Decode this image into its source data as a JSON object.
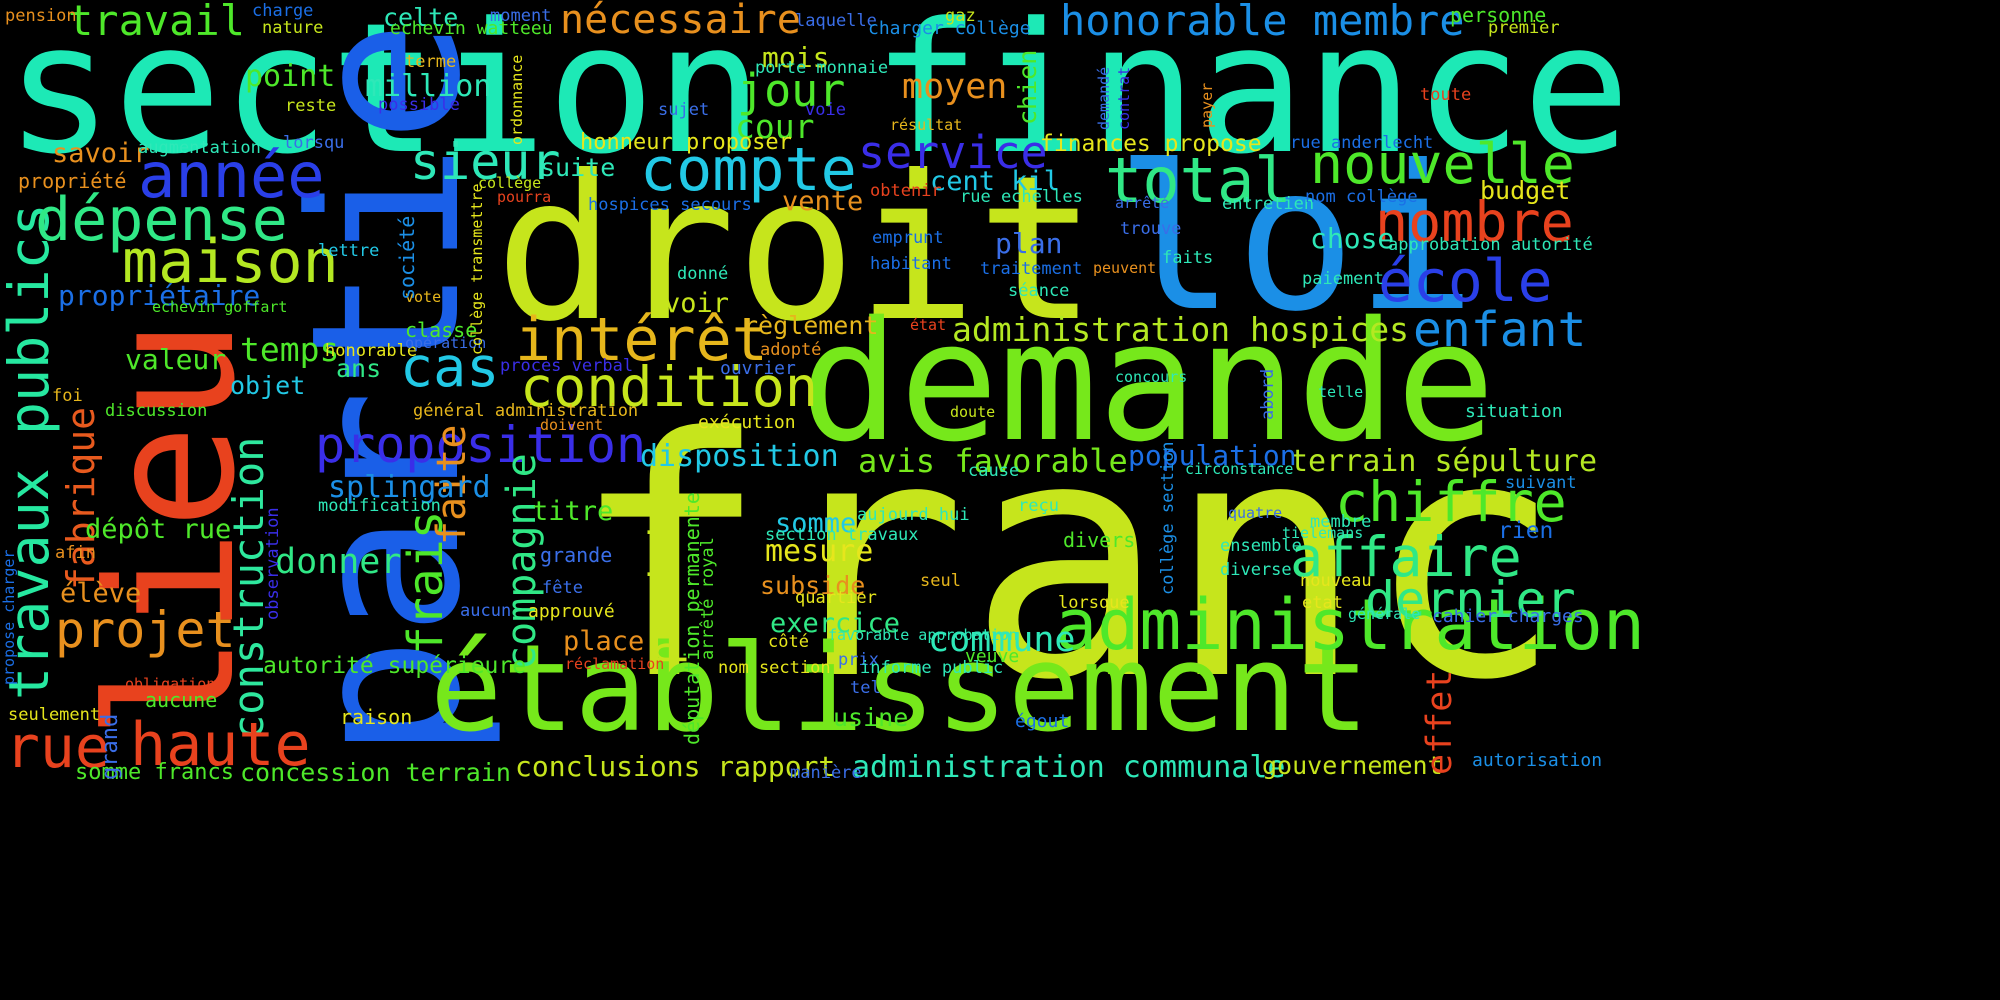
{
  "words": [
    {
      "text": "section finance",
      "color": "#1de9b6",
      "vertical": false
    },
    {
      "text": "franc",
      "color": "#c6e51c",
      "vertical": false
    },
    {
      "text": "partie",
      "color": "#1a5fe8",
      "vertical": true
    },
    {
      "text": "lieu",
      "color": "#e8421e",
      "vertical": true
    },
    {
      "text": "droit",
      "color": "#c6e51c",
      "vertical": false
    },
    {
      "text": "loi",
      "color": "#1b8fe6",
      "vertical": false
    },
    {
      "text": "demande",
      "color": "#76e81b",
      "vertical": false
    },
    {
      "text": "établissement",
      "color": "#76e81b",
      "vertical": false
    },
    {
      "text": "administration",
      "color": "#4ee82a",
      "vertical": false
    },
    {
      "text": "travaux publics",
      "color": "#26e8a0",
      "vertical": true
    },
    {
      "text": "construction",
      "color": "#2ee89e",
      "vertical": true
    },
    {
      "text": "compte",
      "color": "#22c9e6",
      "vertical": false
    },
    {
      "text": "année",
      "color": "#2a3fe8",
      "vertical": false
    },
    {
      "text": "dépense",
      "color": "#30e886",
      "vertical": false
    },
    {
      "text": "maison",
      "color": "#b4e822",
      "vertical": false
    },
    {
      "text": "condition",
      "color": "#c6e51c",
      "vertical": false
    },
    {
      "text": "intérêt",
      "color": "#e6b61c",
      "vertical": false
    },
    {
      "text": "proposition",
      "color": "#3a2ee8",
      "vertical": false
    },
    {
      "text": "cas",
      "color": "#22c9e6",
      "vertical": false
    },
    {
      "text": "sieur",
      "color": "#2ee8b8",
      "vertical": false
    },
    {
      "text": "total",
      "color": "#30e886",
      "vertical": false
    },
    {
      "text": "nouvelle",
      "color": "#4ee82a",
      "vertical": false
    },
    {
      "text": "nombre",
      "color": "#e8421e",
      "vertical": false
    },
    {
      "text": "école",
      "color": "#2a3fe8",
      "vertical": false
    },
    {
      "text": "enfant",
      "color": "#1b8fe6",
      "vertical": false
    },
    {
      "text": "chiffre",
      "color": "#4ee82a",
      "vertical": false
    },
    {
      "text": "affaire",
      "color": "#30e886",
      "vertical": false
    },
    {
      "text": "dernier",
      "color": "#30e886",
      "vertical": false
    },
    {
      "text": "haute",
      "color": "#e8421e",
      "vertical": false
    },
    {
      "text": "rue",
      "color": "#e8421e",
      "vertical": false
    },
    {
      "text": "projet",
      "color": "#e8901e",
      "vertical": false
    },
    {
      "text": "fabrique",
      "color": "#e85a1e",
      "vertical": true
    },
    {
      "text": "frais",
      "color": "#4ee82a",
      "vertical": true
    },
    {
      "text": "faite",
      "color": "#e8901e",
      "vertical": true
    },
    {
      "text": "compagnie",
      "color": "#30e886",
      "vertical": true
    },
    {
      "text": "produit",
      "color": "#c6e51c",
      "vertical": true
    },
    {
      "text": "jour",
      "color": "#4ee82a",
      "vertical": false
    },
    {
      "text": "service",
      "color": "#3a2ee8",
      "vertical": false
    },
    {
      "text": "travail",
      "color": "#4ee82a",
      "vertical": false
    },
    {
      "text": "nécessaire",
      "color": "#e8901e",
      "vertical": false
    },
    {
      "text": "honorable membre",
      "color": "#1b8fe6",
      "vertical": false
    },
    {
      "text": "administration hospices",
      "color": "#b4e822",
      "vertical": false
    },
    {
      "text": "avis favorable",
      "color": "#76e81b",
      "vertical": false
    },
    {
      "text": "terrain sépulture",
      "color": "#b4e822",
      "vertical": false
    },
    {
      "text": "administration communale",
      "color": "#2ee8b8",
      "vertical": false
    },
    {
      "text": "conclusions rapport",
      "color": "#c6e51c",
      "vertical": false
    },
    {
      "text": "gouvernement",
      "color": "#c6e51c",
      "vertical": false
    },
    {
      "text": "concession terrain",
      "color": "#4ee82a",
      "vertical": false
    },
    {
      "text": "somme francs",
      "color": "#4ee82a",
      "vertical": false
    },
    {
      "text": "commune",
      "color": "#2ee8b8",
      "vertical": false
    },
    {
      "text": "exercice",
      "color": "#30e886",
      "vertical": false
    },
    {
      "text": "disposition",
      "color": "#22c9e6",
      "vertical": false
    },
    {
      "text": "splingard",
      "color": "#1b8fe6",
      "vertical": false
    },
    {
      "text": "mesure",
      "color": "#e6e61c",
      "vertical": false
    },
    {
      "text": "subside",
      "color": "#e8901e",
      "vertical": false
    },
    {
      "text": "somme",
      "color": "#22c9e6",
      "vertical": false
    },
    {
      "text": "donner",
      "color": "#30e886",
      "vertical": false
    },
    {
      "text": "temps",
      "color": "#4ee82a",
      "vertical": false
    },
    {
      "text": "propriétaire",
      "color": "#1b6fe6",
      "vertical": false
    },
    {
      "text": "valeur",
      "color": "#4ee82a",
      "vertical": false
    },
    {
      "text": "objet",
      "color": "#22c9e6",
      "vertical": false
    },
    {
      "text": "ans",
      "color": "#30e886",
      "vertical": false
    },
    {
      "text": "usine",
      "color": "#4ee82a",
      "vertical": false
    },
    {
      "text": "place",
      "color": "#e8901e",
      "vertical": false
    },
    {
      "text": "titre",
      "color": "#4ee82a",
      "vertical": false
    },
    {
      "text": "voir",
      "color": "#c6e51c",
      "vertical": false
    },
    {
      "text": "règlement",
      "color": "#e6b61c",
      "vertical": false
    },
    {
      "text": "plan",
      "color": "#3a6ee8",
      "vertical": false
    },
    {
      "text": "chose",
      "color": "#2ee8b8",
      "vertical": false
    },
    {
      "text": "population",
      "color": "#1b6fe6",
      "vertical": false
    },
    {
      "text": "budget",
      "color": "#e6e61c",
      "vertical": false
    },
    {
      "text": "cour",
      "color": "#4ee82a",
      "vertical": false
    },
    {
      "text": "mois",
      "color": "#c6e51c",
      "vertical": false
    },
    {
      "text": "moyen",
      "color": "#e8901e",
      "vertical": false
    },
    {
      "text": "point",
      "color": "#4ee82a",
      "vertical": false
    },
    {
      "text": "million",
      "color": "#2ee8b8",
      "vertical": false
    },
    {
      "text": "celte",
      "color": "#2ee8b8",
      "vertical": false
    },
    {
      "text": "savoir",
      "color": "#e8901e",
      "vertical": false
    },
    {
      "text": "dépôt rue",
      "color": "#4ee82a",
      "vertical": false
    },
    {
      "text": "élève",
      "color": "#e8901e",
      "vertical": false
    },
    {
      "text": "autorité supérieure",
      "color": "#4ee82a",
      "vertical": false
    },
    {
      "text": "suite",
      "color": "#2ee8b8",
      "vertical": false
    },
    {
      "text": "vente",
      "color": "#e8901e",
      "vertical": false
    },
    {
      "text": "cent kil",
      "color": "#22c9e6",
      "vertical": false
    },
    {
      "text": "finances propose",
      "color": "#e6e61c",
      "vertical": false
    },
    {
      "text": "honneur proposer",
      "color": "#e6e61c",
      "vertical": false
    },
    {
      "text": "pension",
      "color": "#e8901e",
      "vertical": false
    },
    {
      "text": "charge",
      "color": "#1b6fe6",
      "vertical": false
    },
    {
      "text": "nature",
      "color": "#c6e51c",
      "vertical": false
    },
    {
      "text": "echevin watteeu",
      "color": "#4ee82a",
      "vertical": false
    },
    {
      "text": "moment",
      "color": "#3a6ee8",
      "vertical": false
    },
    {
      "text": "laquelle",
      "color": "#3a6ee8",
      "vertical": false
    },
    {
      "text": "charger collège",
      "color": "#1b8fe6",
      "vertical": false
    },
    {
      "text": "gaz",
      "color": "#c6e51c",
      "vertical": false
    },
    {
      "text": "personne",
      "color": "#4ee82a",
      "vertical": false
    },
    {
      "text": "premier",
      "color": "#c6e51c",
      "vertical": false
    },
    {
      "text": "terme",
      "color": "#e6b61c",
      "vertical": false
    },
    {
      "text": "porte monnaie",
      "color": "#2ee8b8",
      "vertical": false
    },
    {
      "text": "reste",
      "color": "#c6e51c",
      "vertical": false
    },
    {
      "text": "possible",
      "color": "#3a2ee8",
      "vertical": false
    },
    {
      "text": "sujet",
      "color": "#3a6ee8",
      "vertical": false
    },
    {
      "text": "voie",
      "color": "#3a2ee8",
      "vertical": false
    },
    {
      "text": "résultat",
      "color": "#e6b61c",
      "vertical": false
    },
    {
      "text": "toute",
      "color": "#e8421e",
      "vertical": false
    },
    {
      "text": "rue anderlecht",
      "color": "#1b6fe6",
      "vertical": false
    },
    {
      "text": "augmentation",
      "color": "#2ee8b8",
      "vertical": false
    },
    {
      "text": "lorsqu",
      "color": "#3a6ee8",
      "vertical": false
    },
    {
      "text": "propriété",
      "color": "#e8901e",
      "vertical": false
    },
    {
      "text": "collège",
      "color": "#c6e51c",
      "vertical": false
    },
    {
      "text": "pourra",
      "color": "#e8421e",
      "vertical": false
    },
    {
      "text": "hospices secours",
      "color": "#1b6fe6",
      "vertical": false
    },
    {
      "text": "obtenir",
      "color": "#e8421e",
      "vertical": false
    },
    {
      "text": "rue echelles",
      "color": "#2ee8b8",
      "vertical": false
    },
    {
      "text": "arrêté",
      "color": "#3a6ee8",
      "vertical": false
    },
    {
      "text": "entretien",
      "color": "#2ee8b8",
      "vertical": false
    },
    {
      "text": "nom collège",
      "color": "#1b6fe6",
      "vertical": false
    },
    {
      "text": "trouve",
      "color": "#3a6ee8",
      "vertical": false
    },
    {
      "text": "approbation autorité",
      "color": "#2ee8b8",
      "vertical": false
    },
    {
      "text": "lettre",
      "color": "#22c9e6",
      "vertical": false
    },
    {
      "text": "emprunt",
      "color": "#1b6fe6",
      "vertical": false
    },
    {
      "text": "habitant",
      "color": "#1b6fe6",
      "vertical": false
    },
    {
      "text": "traitement",
      "color": "#1b6fe6",
      "vertical": false
    },
    {
      "text": "faits",
      "color": "#2ee8b8",
      "vertical": false
    },
    {
      "text": "peuvent",
      "color": "#e8901e",
      "vertical": false
    },
    {
      "text": "paiement",
      "color": "#2ee8b8",
      "vertical": false
    },
    {
      "text": "séance",
      "color": "#2ee8b8",
      "vertical": false
    },
    {
      "text": "vote",
      "color": "#e6b61c",
      "vertical": false
    },
    {
      "text": "echevin goffart",
      "color": "#4ee82a",
      "vertical": false
    },
    {
      "text": "classe",
      "color": "#4ee82a",
      "vertical": false
    },
    {
      "text": "honorable",
      "color": "#e6e61c",
      "vertical": false
    },
    {
      "text": "opération",
      "color": "#3a6ee8",
      "vertical": false
    },
    {
      "text": "état",
      "color": "#e8421e",
      "vertical": false
    },
    {
      "text": "adopté",
      "color": "#e8901e",
      "vertical": false
    },
    {
      "text": "donné",
      "color": "#2ee8b8",
      "vertical": false
    },
    {
      "text": "foi",
      "color": "#e6b61c",
      "vertical": false
    },
    {
      "text": "discussion",
      "color": "#4ee82a",
      "vertical": false
    },
    {
      "text": "proces verbal",
      "color": "#3a2ee8",
      "vertical": false
    },
    {
      "text": "ouvrier",
      "color": "#3a6ee8",
      "vertical": false
    },
    {
      "text": "général administration",
      "color": "#e6b61c",
      "vertical": false
    },
    {
      "text": "doivent",
      "color": "#e8901e",
      "vertical": false
    },
    {
      "text": "exécution",
      "color": "#e6e61c",
      "vertical": false
    },
    {
      "text": "doute",
      "color": "#c6e51c",
      "vertical": false
    },
    {
      "text": "concours",
      "color": "#2ee8b8",
      "vertical": false
    },
    {
      "text": "telle",
      "color": "#2ee8b8",
      "vertical": false
    },
    {
      "text": "situation",
      "color": "#2ee8b8",
      "vertical": false
    },
    {
      "text": "cause",
      "color": "#2ee8b8",
      "vertical": false
    },
    {
      "text": "circonstance",
      "color": "#2ee8b8",
      "vertical": false
    },
    {
      "text": "suivant",
      "color": "#1b8fe6",
      "vertical": false
    },
    {
      "text": "reçu",
      "color": "#2ee8b8",
      "vertical": false
    },
    {
      "text": "modification",
      "color": "#2ee8b8",
      "vertical": false
    },
    {
      "text": "aujourd hui",
      "color": "#2ee8b8",
      "vertical": false
    },
    {
      "text": "section travaux",
      "color": "#2ee8b8",
      "vertical": false
    },
    {
      "text": "divers",
      "color": "#4ee82a",
      "vertical": false
    },
    {
      "text": "quatre",
      "color": "#3a6ee8",
      "vertical": false
    },
    {
      "text": "membre",
      "color": "#2ee8b8",
      "vertical": false
    },
    {
      "text": "tielemans",
      "color": "#2ee8b8",
      "vertical": false
    },
    {
      "text": "rien",
      "color": "#1b6fe6",
      "vertical": false
    },
    {
      "text": "ensemble",
      "color": "#2ee8b8",
      "vertical": false
    },
    {
      "text": "diverse",
      "color": "#2ee8b8",
      "vertical": false
    },
    {
      "text": "nouveau",
      "color": "#e6e61c",
      "vertical": false
    },
    {
      "text": "générale",
      "color": "#2ee8b8",
      "vertical": false
    },
    {
      "text": "cahier charges",
      "color": "#3a6ee8",
      "vertical": false
    },
    {
      "text": "etat",
      "color": "#e6e61c",
      "vertical": false
    },
    {
      "text": "lorsque",
      "color": "#e6e61c",
      "vertical": false
    },
    {
      "text": "quartier",
      "color": "#e6e61c",
      "vertical": false
    },
    {
      "text": "seul",
      "color": "#e6b61c",
      "vertical": false
    },
    {
      "text": "fête",
      "color": "#3a6ee8",
      "vertical": false
    },
    {
      "text": "grande",
      "color": "#3a6ee8",
      "vertical": false
    },
    {
      "text": "approuvé",
      "color": "#e6e61c",
      "vertical": false
    },
    {
      "text": "aucun",
      "color": "#3a6ee8",
      "vertical": false
    },
    {
      "text": "côté",
      "color": "#e6e61c",
      "vertical": false
    },
    {
      "text": "favorable approbation",
      "color": "#2ee8b8",
      "vertical": false
    },
    {
      "text": "afin",
      "color": "#e8901e",
      "vertical": false
    },
    {
      "text": "réclamation",
      "color": "#e8421e",
      "vertical": false
    },
    {
      "text": "nom section",
      "color": "#e6e61c",
      "vertical": false
    },
    {
      "text": "prix",
      "color": "#3a6ee8",
      "vertical": false
    },
    {
      "text": "informe public",
      "color": "#2ee8b8",
      "vertical": false
    },
    {
      "text": "veuve",
      "color": "#4ee82a",
      "vertical": false
    },
    {
      "text": "tel",
      "color": "#3a6ee8",
      "vertical": false
    },
    {
      "text": "obligation",
      "color": "#e8421e",
      "vertical": false
    },
    {
      "text": "aucune",
      "color": "#4ee82a",
      "vertical": false
    },
    {
      "text": "seulement",
      "color": "#e6e61c",
      "vertical": false
    },
    {
      "text": "raison",
      "color": "#e6e61c",
      "vertical": false
    },
    {
      "text": "égout",
      "color": "#1b6fe6",
      "vertical": false
    },
    {
      "text": "manière",
      "color": "#3a6ee8",
      "vertical": false
    },
    {
      "text": "autorisation",
      "color": "#1b8fe6",
      "vertical": false
    },
    {
      "text": "effet",
      "color": "#e8421e",
      "vertical": true
    },
    {
      "text": "grand",
      "color": "#3a6ee8",
      "vertical": true
    },
    {
      "text": "société",
      "color": "#1b8fe6",
      "vertical": true
    },
    {
      "text": "collège transmettre",
      "color": "#e6e61c",
      "vertical": true
    },
    {
      "text": "ordonnance",
      "color": "#e6e61c",
      "vertical": true
    },
    {
      "text": "chien",
      "color": "#4ee82a",
      "vertical": true
    },
    {
      "text": "demandé",
      "color": "#3a6ee8",
      "vertical": true
    },
    {
      "text": "contrat",
      "color": "#3a2ee8",
      "vertical": true
    },
    {
      "text": "payer",
      "color": "#e8901e",
      "vertical": true
    },
    {
      "text": "abord",
      "color": "#3a6ee8",
      "vertical": true
    },
    {
      "text": "collège section",
      "color": "#1b8fe6",
      "vertical": true
    },
    {
      "text": "observation",
      "color": "#3a2ee8",
      "vertical": true
    },
    {
      "text": "propose charger",
      "color": "#1b6fe6",
      "vertical": true
    },
    {
      "text": "députation permanente",
      "color": "#4ee82a",
      "vertical": true
    },
    {
      "text": "arrêté royal",
      "color": "#4ee82a",
      "vertical": true
    }
  ]
}
